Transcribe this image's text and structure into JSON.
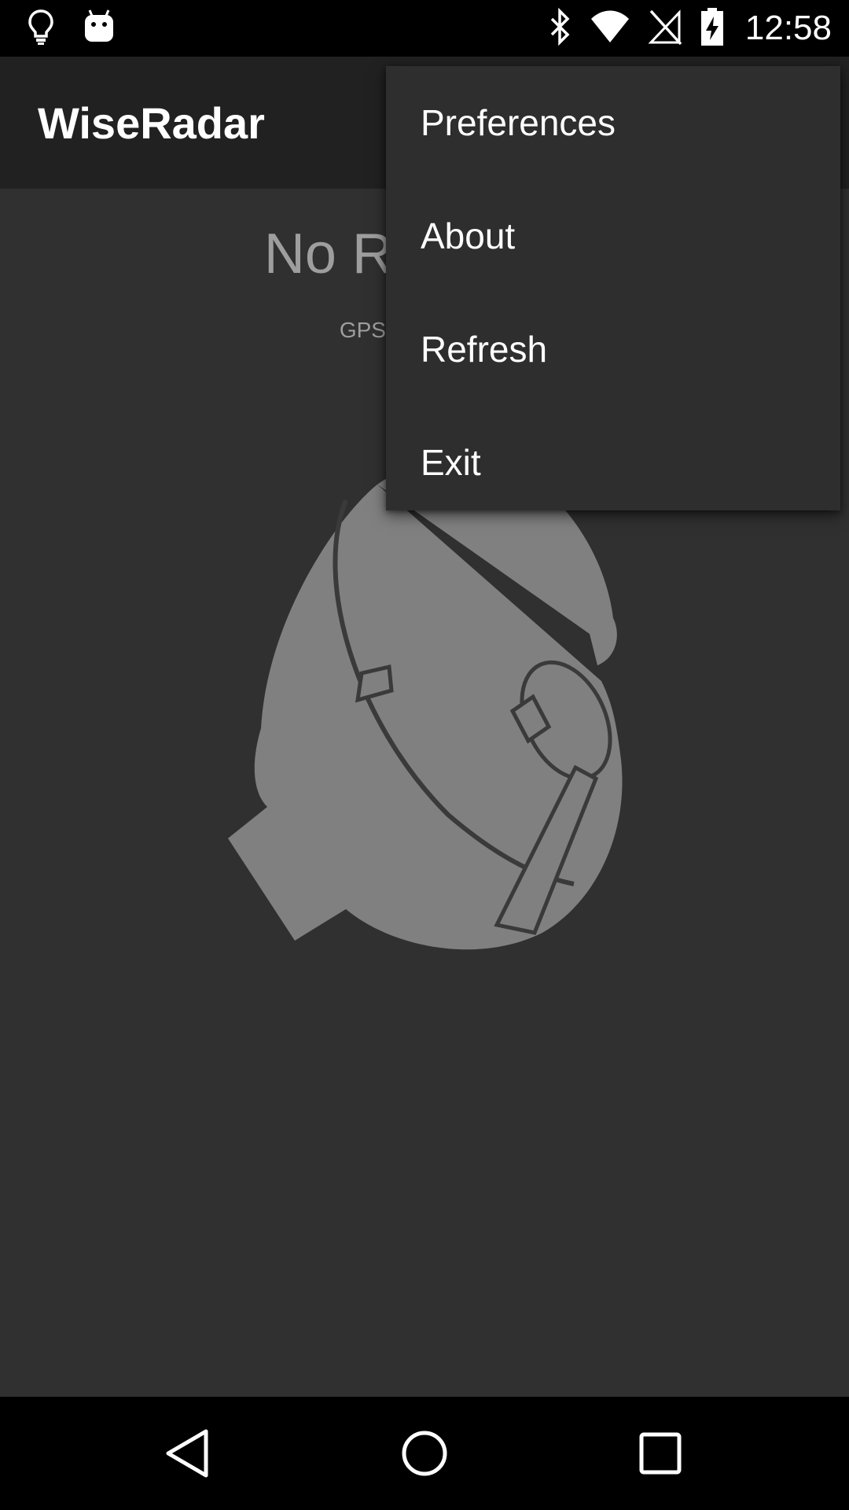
{
  "status_bar": {
    "time": "12:58",
    "icons": [
      "lightbulb-icon",
      "android-icon",
      "bluetooth-icon",
      "wifi-icon",
      "no-sim-icon",
      "battery-charging-icon"
    ]
  },
  "app_bar": {
    "title": "WiseRadar"
  },
  "main": {
    "headline": "No Radar Lo",
    "subline": "GPS features are",
    "image": "radar-dish-icon"
  },
  "overflow_menu": {
    "items": [
      {
        "label": "Preferences"
      },
      {
        "label": "About"
      },
      {
        "label": "Refresh"
      },
      {
        "label": "Exit"
      }
    ]
  },
  "nav_bar": {
    "icons": [
      "back-icon",
      "home-icon",
      "recents-icon"
    ]
  },
  "colors": {
    "background": "#303030",
    "app_bar": "#212121",
    "menu": "#2e2e2e",
    "text_secondary": "#9e9e9e"
  }
}
